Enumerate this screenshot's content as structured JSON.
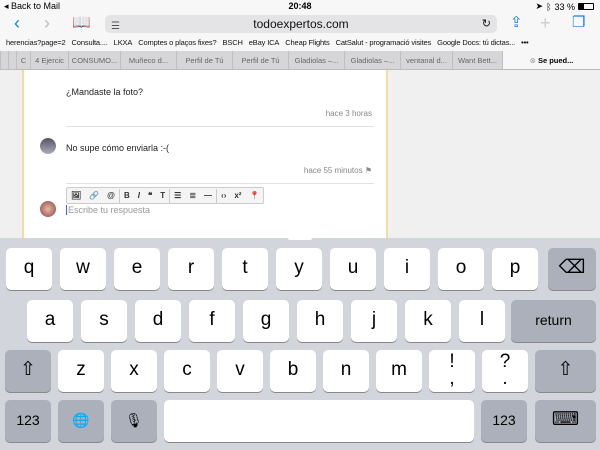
{
  "status": {
    "back": "◂ Back to Mail",
    "time": "20:48",
    "battery": "33 %",
    "battery_level": 0.33
  },
  "nav": {
    "url": "todoexpertos.com"
  },
  "bookmarks": [
    "herencias?page=2",
    "Consulta....",
    "LKXA",
    "Comptes o plaços fixes?",
    "BSCH",
    "eBay ICA",
    "Cheap Flights",
    "CatSalut - programació visites",
    "Google Docs: tú dictas...",
    "•••"
  ],
  "tabs": [
    "C",
    "4 Ejercic",
    "CONSUMO...",
    "Muñeco d...",
    "Perfil de Tú",
    "Perfil de Tú",
    "Gladiolas –...",
    "Gladiolas –...",
    "ventanal d...",
    "Want Bett...",
    "Se pued..."
  ],
  "thread": {
    "msg1": "¿Mandaste la foto?",
    "time1": "hace 3 horas",
    "msg2": "No supe cómo enviarla :-(",
    "time2": "hace 55 minutos",
    "reply_placeholder": "Escribe tu respuesta"
  },
  "keyboard": {
    "row1": [
      "q",
      "w",
      "e",
      "r",
      "t",
      "y",
      "u",
      "i",
      "o",
      "p"
    ],
    "row2": [
      "a",
      "s",
      "d",
      "f",
      "g",
      "h",
      "j",
      "k",
      "l"
    ],
    "row3": [
      "z",
      "x",
      "c",
      "v",
      "b",
      "n",
      "m",
      "!\n,",
      "?\n."
    ],
    "return": "return",
    "numbers": "123"
  }
}
